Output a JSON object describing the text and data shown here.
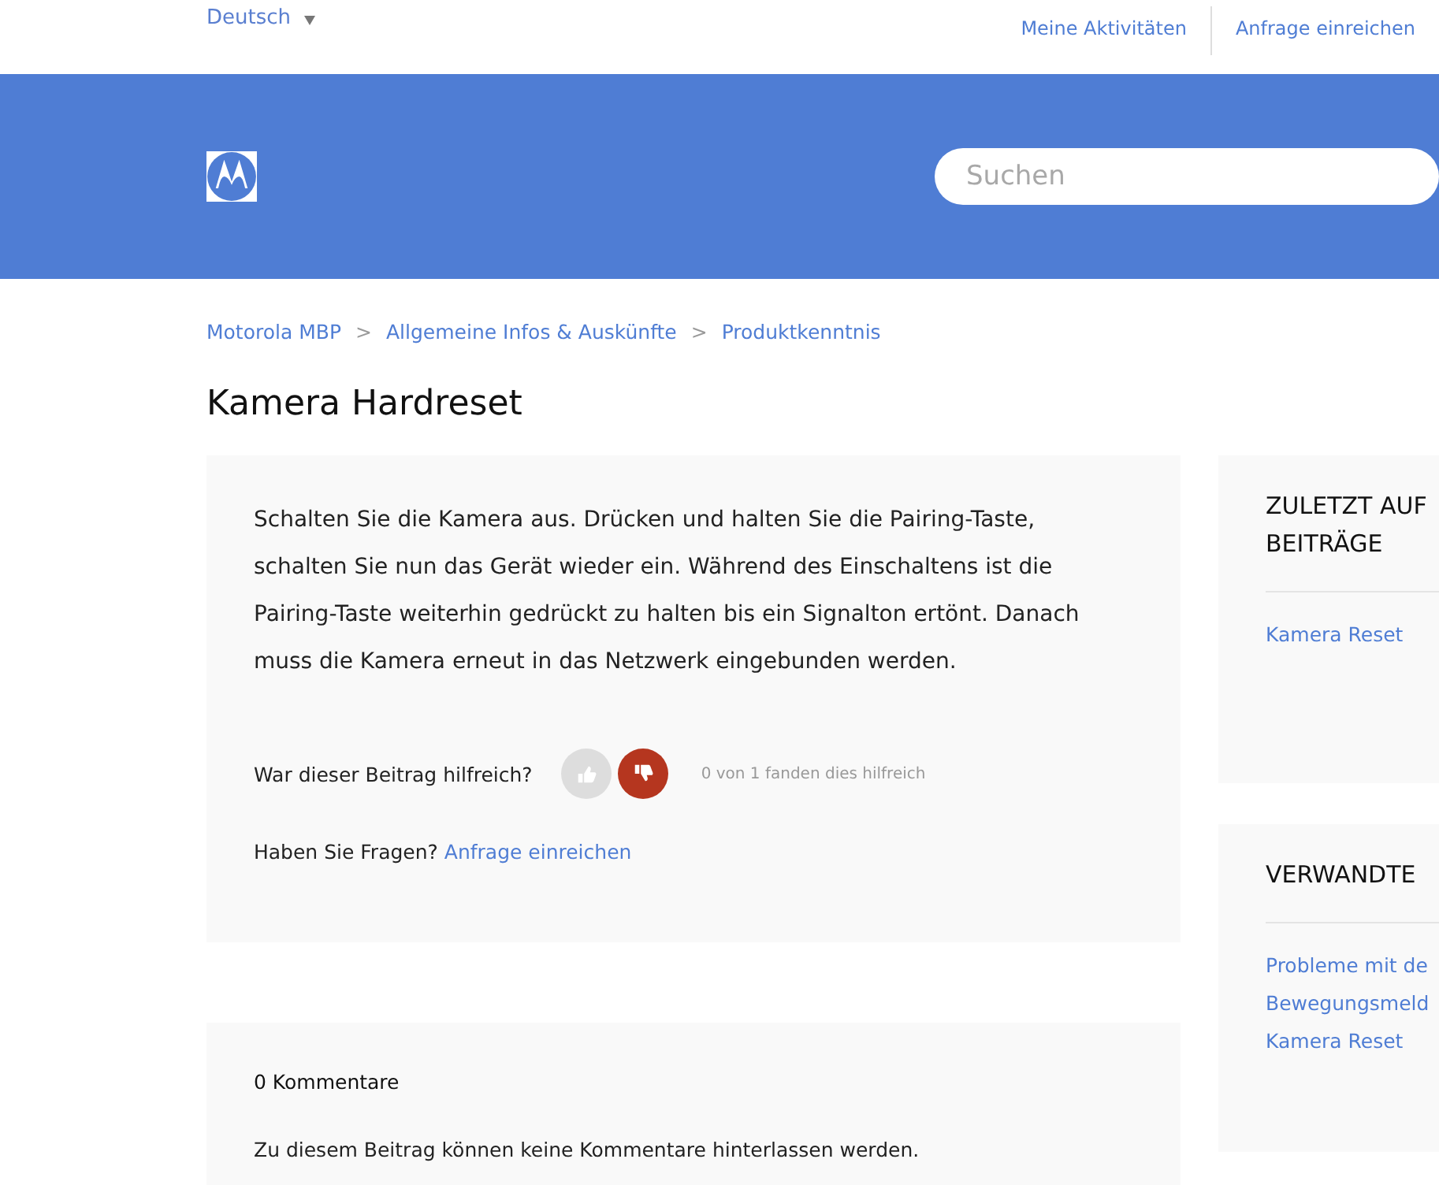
{
  "topbar": {
    "language": "Deutsch",
    "nav": [
      "Meine Aktivitäten",
      "Anfrage einreichen"
    ]
  },
  "header": {
    "search": {
      "placeholder": "Suchen"
    }
  },
  "breadcrumbs": [
    "Motorola MBP",
    "Allgemeine Infos & Auskünfte",
    "Produktkenntnis"
  ],
  "breadcrumb_separator": ">",
  "article": {
    "title": "Kamera Hardreset",
    "body": "Schalten Sie die Kamera aus. Drücken und halten Sie die Pairing-Taste, schalten Sie nun das Gerät wieder ein. Während des Einschaltens ist die Pairing-Taste weiterhin gedrückt zu halten bis ein Signalton ertönt. Danach muss die Kamera erneut in das Netzwerk eingebunden werden.",
    "vote_question": "War dieser Beitrag hilfreich?",
    "votes": [
      {
        "kind": "up",
        "selected": false
      },
      {
        "kind": "down",
        "selected": true
      }
    ],
    "vote_count": "0 von 1 fanden dies hilfreich",
    "questions_label": "Haben Sie Fragen?",
    "questions_link": "Anfrage einreichen"
  },
  "comments": {
    "count": "0 Kommentare",
    "notice": "Zu diesem Beitrag können keine Kommentare hinterlassen werden."
  },
  "sidebar": [
    {
      "title": [
        "ZULETZT AUF",
        "BEITRÄGE"
      ],
      "links": [
        "Kamera Reset"
      ]
    },
    {
      "title": [
        "VERWANDTE"
      ],
      "links": [
        "Probleme mit de",
        "Bewegungsmeld",
        "Kamera Reset"
      ]
    }
  ]
}
